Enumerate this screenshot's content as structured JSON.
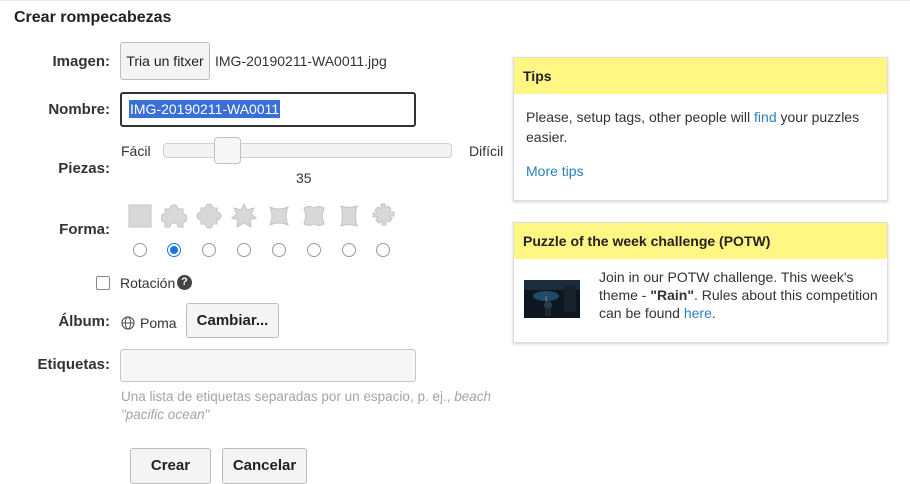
{
  "form": {
    "title": "Crear rompecabezas",
    "image_label": "Imagen:",
    "file_button": "Tria un fitxer",
    "file_name": "IMG-20190211-WA0011.jpg",
    "name_label": "Nombre:",
    "name_value": "IMG-20190211-WA0011",
    "pieces_label": "Piezas:",
    "pieces_easy": "Fácil",
    "pieces_hard": "Difícil",
    "pieces_value": "35",
    "pieces_slider_fraction": 0.23,
    "shape_label": "Forma:",
    "shapes": [
      "square-icon",
      "jigsaw-classic-icon",
      "jigsaw-round-icon",
      "jigsaw-star-icon",
      "jigsaw-wavy-icon",
      "jigsaw-tile-icon",
      "jigsaw-curved-icon",
      "jigsaw-gear-icon"
    ],
    "selected_shape_index": 1,
    "rotation_label": "Rotación",
    "rotation_checked": false,
    "album_label": "Álbum:",
    "album_name": "Poma",
    "album_button": "Cambiar...",
    "tags_label": "Etiquetas:",
    "tags_value": "",
    "tags_hint_main": "Una lista de etiquetas separadas por un espacio, p. ej., ",
    "tags_hint_example_1": "beach",
    "tags_hint_example_2": "\"pacific ocean\"",
    "create_button": "Crear",
    "cancel_button": "Cancelar"
  },
  "tips": {
    "header": "Tips",
    "text_before": "Please, setup tags, other people will ",
    "link": "find",
    "text_after": " your puzzles easier.",
    "more": "More tips"
  },
  "potw": {
    "header": "Puzzle of the week challenge (POTW)",
    "text_1": "Join in our POTW challenge. This week's theme - ",
    "theme": "\"Rain\"",
    "text_2": ". Rules about this competition can be found ",
    "link": "here",
    "text_3": "."
  },
  "colors": {
    "accent": "#1a73e8",
    "link": "#2a7fc0",
    "panel_header": "#fff684",
    "selection": "#3b6fd8"
  }
}
